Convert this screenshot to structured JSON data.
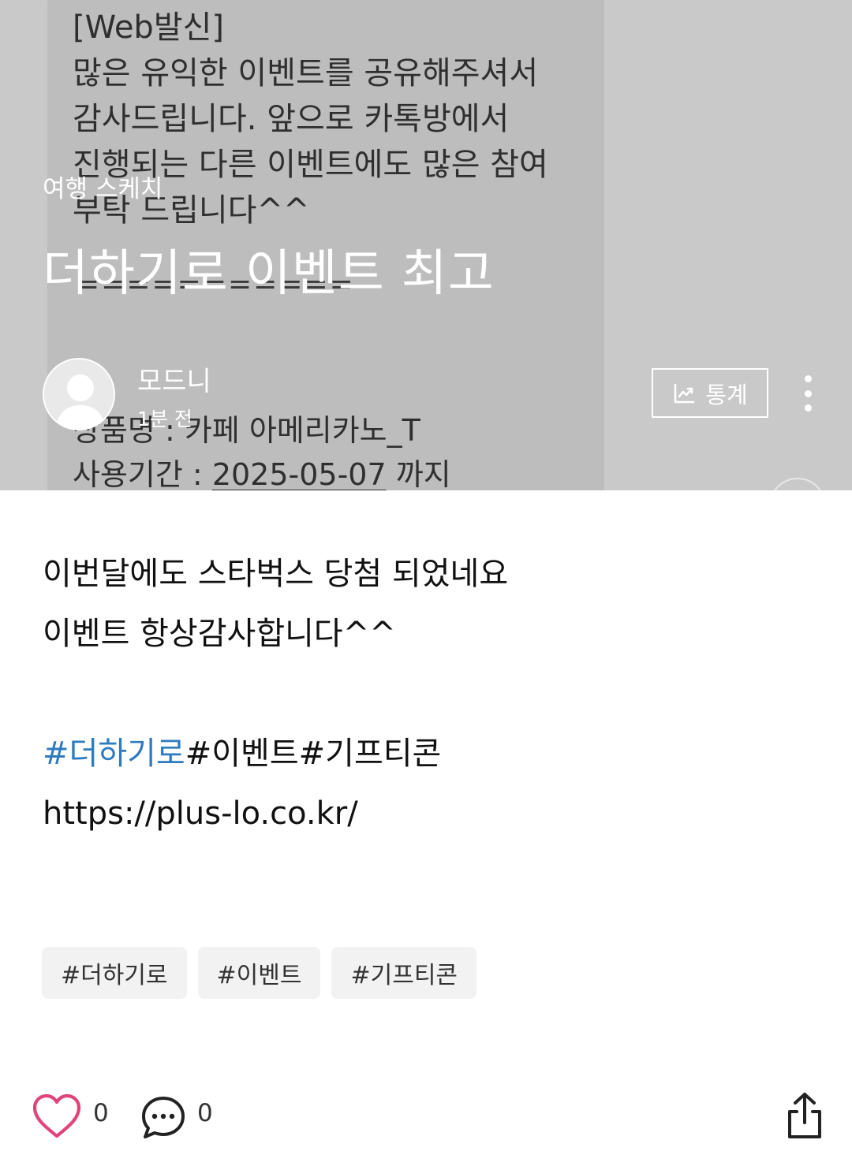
{
  "cover": {
    "message_text": "[Web발신]\n많은 유익한 이벤트를 공유해주셔서\n감사드립니다. 앞으로 카톡방에서\n진행되는 다른 이벤트에도 많은 참여\n부탁 드립니다^^",
    "divider": "===========",
    "product_line": "상품명 : 카페 아메리카노_T",
    "period_label": "사용기간 : ",
    "period_date": "2025-05-07",
    "period_suffix": " 까지"
  },
  "header": {
    "category": "여행 스케치",
    "title": "더하기로 이벤트 최고",
    "author": "모드니",
    "time_ago": "1분 전",
    "stats_label": "통계"
  },
  "content": {
    "line1": "이번달에도 스타벅스 당첨 되었네요",
    "line2": "이벤트 항상감사합니다^^",
    "hashtag_link": "#더하기로",
    "hashtag_rest": "#이벤트#기프티콘",
    "url": "https://plus-lo.co.kr/"
  },
  "tags": [
    "#더하기로",
    "#이벤트",
    "#기프티콘"
  ],
  "actions": {
    "like_count": "0",
    "comment_count": "0"
  },
  "colors": {
    "accent_link": "#2f7bbf",
    "like_icon": "#e0447a",
    "tag_bg": "#f2f2f2"
  },
  "icons": [
    "chart-icon",
    "more-vertical-icon",
    "heart-icon",
    "comment-icon",
    "share-icon",
    "avatar-icon"
  ]
}
